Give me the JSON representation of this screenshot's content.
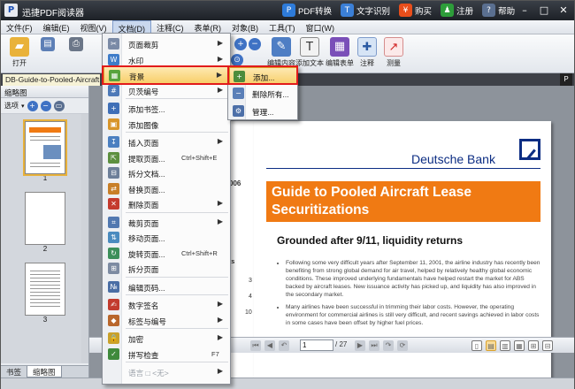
{
  "app": {
    "title": "迅捷PDF阅读器",
    "icon": "P",
    "actions": [
      {
        "label": "PDF转换",
        "icon": "convert-icon",
        "color": "#2e7bd9",
        "glyph": "P"
      },
      {
        "label": "文字识别",
        "icon": "ocr-icon",
        "color": "#3b7fd6",
        "glyph": "T"
      },
      {
        "label": "购买",
        "icon": "cart-icon",
        "color": "#e94e1b",
        "glyph": "¥"
      },
      {
        "label": "注册",
        "icon": "user-icon",
        "color": "#2d9d3a",
        "glyph": "♟"
      },
      {
        "label": "帮助",
        "icon": "help-icon",
        "color": "#5a6f90",
        "glyph": "?"
      }
    ]
  },
  "menubar": [
    "文件(F)",
    "编辑(E)",
    "视图(V)",
    "文档(D)",
    "注释(C)",
    "表单(R)",
    "对象(B)",
    "工具(T)",
    "窗口(W)"
  ],
  "toolbar": {
    "open_label": "打开",
    "buttons": [
      "编辑内容",
      "添加文本",
      "编辑表单",
      "注释",
      "测量"
    ]
  },
  "doc_tab": "DB-Guide-to-Pooled-Aircraft",
  "left_panel": {
    "header": "缩略图",
    "tools_label": "选项",
    "thumb_labels": [
      "1",
      "2",
      "3"
    ],
    "tabs": [
      "书签",
      "缩略图"
    ]
  },
  "page": {
    "bank_name": "Deutsche Bank",
    "title": "Guide to Pooled Aircraft Lease Securitizations",
    "subtitle": "Grounded after 9/11, liquidity returns",
    "bullets": [
      "Following some very difficult years after September 11, 2001, the airline industry has recently been benefiting from strong global demand for air travel, helped by relatively healthy global economic conditions. These improved underlying fundamentals have helped restart the market for ABS backed by aircraft leases. New issuance activity has picked up, and liquidity has also improved in the secondary market.",
      "Many airlines have been successful in trimming their labor costs. However, the operating environment for commercial airlines is still very difficult, and recent savings achieved in labor costs in some cases have been offset by higher fuel prices."
    ],
    "left_frag": {
      "year": "006",
      "toc": "ts",
      "n1": "3",
      "n2": "4",
      "n3": "10"
    }
  },
  "navbar": {
    "page": "1",
    "total": "/ 27"
  },
  "doc_menu": {
    "items": [
      {
        "label": "页面裁剪",
        "icon": "crop-icon",
        "color": "#7a8aa6",
        "glyph": "✂",
        "arrow": true
      },
      {
        "label": "水印",
        "icon": "watermark-icon",
        "color": "#3e7cc9",
        "glyph": "W",
        "arrow": true
      },
      {
        "label": "背景",
        "icon": "background-icon",
        "color": "#58a33c",
        "glyph": "▦",
        "arrow": true,
        "highlight": true
      },
      {
        "label": "贝茨编号",
        "icon": "bates-icon",
        "color": "#4d79b8",
        "glyph": "#",
        "arrow": true
      },
      {
        "sep": true
      },
      {
        "label": "添加书签...",
        "icon": "bookmark-add-icon",
        "color": "#3f6fb7",
        "glyph": "+"
      },
      {
        "label": "添加图像",
        "icon": "image-add-icon",
        "color": "#d8952a",
        "glyph": "▣"
      },
      {
        "sep": true
      },
      {
        "label": "插入页面",
        "icon": "insert-page-icon",
        "color": "#4b7fc0",
        "glyph": "↧",
        "arrow": true
      },
      {
        "label": "提取页面...",
        "icon": "extract-page-icon",
        "color": "#5c8f3f",
        "glyph": "⇱",
        "key": "Ctrl+Shift+E"
      },
      {
        "label": "拆分文档...",
        "icon": "split-doc-icon",
        "color": "#6d7f99",
        "glyph": "⊟"
      },
      {
        "label": "替换页面...",
        "icon": "replace-page-icon",
        "color": "#c87f28",
        "glyph": "⇄"
      },
      {
        "label": "删除页面",
        "icon": "delete-page-icon",
        "color": "#c43a2e",
        "glyph": "✕",
        "arrow": true
      },
      {
        "sep": true
      },
      {
        "label": "裁剪页面",
        "icon": "crop-page-icon",
        "color": "#5178b0",
        "glyph": "⌗",
        "arrow": true
      },
      {
        "label": "移动页面...",
        "icon": "move-page-icon",
        "color": "#4a8bbf",
        "glyph": "⇅"
      },
      {
        "label": "旋转页面...",
        "icon": "rotate-page-icon",
        "color": "#3c8f5a",
        "glyph": "↻",
        "key": "Ctrl+Shift+R"
      },
      {
        "label": "拆分页面",
        "icon": "split-page-icon",
        "color": "#7d8ba2",
        "glyph": "⊞"
      },
      {
        "sep": true
      },
      {
        "label": "编辑页码...",
        "icon": "page-number-icon",
        "color": "#4a6ea5",
        "glyph": "№"
      },
      {
        "sep": true
      },
      {
        "label": "数字签名",
        "icon": "signature-icon",
        "color": "#c23b2e",
        "glyph": "✍",
        "arrow": true
      },
      {
        "label": "标签与编号",
        "icon": "tag-icon",
        "color": "#b9672c",
        "glyph": "◆",
        "arrow": true
      },
      {
        "sep": true
      },
      {
        "label": "加密",
        "icon": "lock-icon",
        "color": "#c9a12b",
        "glyph": "🔒",
        "arrow": true
      },
      {
        "label": "拼写检查",
        "icon": "spellcheck-icon",
        "color": "#3f8a3c",
        "glyph": "✓",
        "key": "F7"
      },
      {
        "sep": true
      },
      {
        "label": "语言 □ <无>",
        "icon": "",
        "color": "",
        "glyph": "",
        "disabled": true,
        "arrow": true
      }
    ]
  },
  "background_submenu": {
    "items": [
      {
        "label": "添加...",
        "icon": "add-bg-icon",
        "color": "#4d8c3c",
        "glyph": "+",
        "highlight": true
      },
      {
        "label": "删除所有...",
        "icon": "remove-bg-icon",
        "color": "#5a7fb8",
        "glyph": "−"
      },
      {
        "label": "管理...",
        "icon": "manage-bg-icon",
        "color": "#4c6fa8",
        "glyph": "⚙"
      }
    ]
  }
}
